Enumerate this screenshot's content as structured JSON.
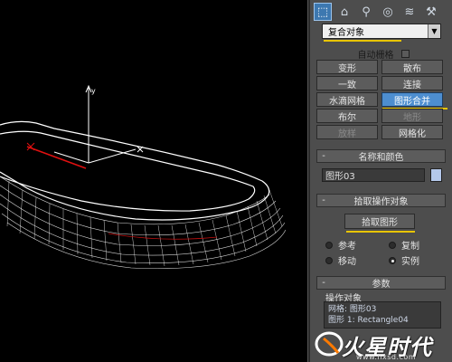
{
  "viewport": {
    "axis_labels": {
      "x_label": "x",
      "y_label": "y"
    }
  },
  "panel": {
    "tabs": [
      {
        "icon": "create-icon"
      },
      {
        "icon": "modify-icon"
      },
      {
        "icon": "hierarchy-icon"
      },
      {
        "icon": "motion-icon"
      },
      {
        "icon": "display-icon"
      },
      {
        "icon": "utilities-icon"
      }
    ],
    "category": "复合对象",
    "auto_grid_label": "自动栅格",
    "buttons": {
      "morph": "变形",
      "scatter": "散布",
      "conform": "一致",
      "connect": "连接",
      "blobmesh": "水滴网格",
      "shape_merge": "图形合并",
      "boolean": "布尔",
      "terrain": "地形",
      "loft": "放样",
      "mesher": "网格化"
    },
    "name_color": {
      "title": "名称和颜色",
      "name": "图形03",
      "color": "#b4c8ea"
    },
    "pick_operand": {
      "title": "拾取操作对象",
      "button": "拾取图形",
      "reference": "参考",
      "copy": "复制",
      "move": "移动",
      "instance": "实例",
      "selected": "instance"
    },
    "parameters": {
      "title": "参数",
      "operands_label": "操作对象",
      "operands": [
        "网格: 图形03",
        "图形 1: Rectangle04"
      ]
    },
    "rollout_sign": "-"
  },
  "watermark": {
    "logo_text": "火星时代",
    "url": "www.hxsd.com"
  }
}
